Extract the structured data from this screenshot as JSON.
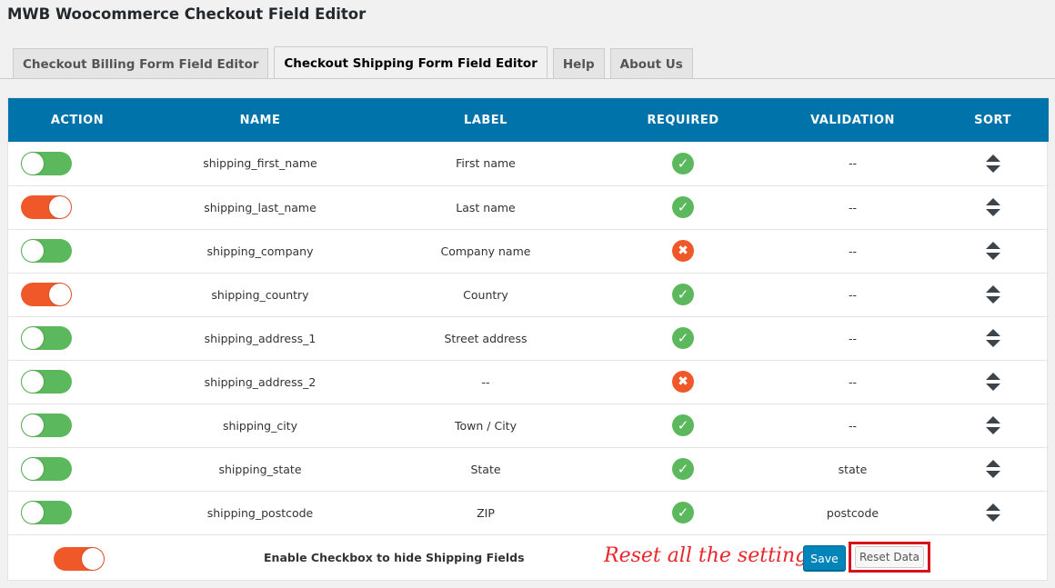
{
  "page": {
    "title": "MWB Woocommerce Checkout Field Editor"
  },
  "tabs": [
    {
      "label": "Checkout Billing Form Field Editor",
      "active": false
    },
    {
      "label": "Checkout Shipping Form Field Editor",
      "active": true
    },
    {
      "label": "Help",
      "active": false
    },
    {
      "label": "About Us",
      "active": false
    }
  ],
  "table": {
    "headers": {
      "action": "ACTION",
      "name": "NAME",
      "label": "LABEL",
      "required": "REQUIRED",
      "validation": "VALIDATION",
      "sort": "SORT"
    },
    "rows": [
      {
        "enabled": true,
        "name": "shipping_first_name",
        "label": "First name",
        "required": true,
        "validation": "--"
      },
      {
        "enabled": false,
        "name": "shipping_last_name",
        "label": "Last name",
        "required": true,
        "validation": "--"
      },
      {
        "enabled": true,
        "name": "shipping_company",
        "label": "Company name",
        "required": false,
        "validation": "--"
      },
      {
        "enabled": false,
        "name": "shipping_country",
        "label": "Country",
        "required": true,
        "validation": "--"
      },
      {
        "enabled": true,
        "name": "shipping_address_1",
        "label": "Street address",
        "required": true,
        "validation": "--"
      },
      {
        "enabled": true,
        "name": "shipping_address_2",
        "label": "--",
        "required": false,
        "validation": "--"
      },
      {
        "enabled": true,
        "name": "shipping_city",
        "label": "Town / City",
        "required": true,
        "validation": "--"
      },
      {
        "enabled": true,
        "name": "shipping_state",
        "label": "State",
        "required": true,
        "validation": "state"
      },
      {
        "enabled": true,
        "name": "shipping_postcode",
        "label": "ZIP",
        "required": true,
        "validation": "postcode"
      }
    ]
  },
  "footer": {
    "hide_toggle_enabled": false,
    "hide_label": "Enable Checkbox to hide Shipping Fields",
    "annotation": "Reset all the setting",
    "save_label": "Save",
    "reset_label": "Reset Data"
  },
  "colors": {
    "header_bg": "#0073aa",
    "toggle_on": "#5cb85c",
    "toggle_off": "#f0582a",
    "annotation": "#e8262c"
  },
  "icons": {
    "required_yes": "check-circle-icon",
    "required_no": "x-circle-icon",
    "sort": "sort-arrows-icon"
  }
}
